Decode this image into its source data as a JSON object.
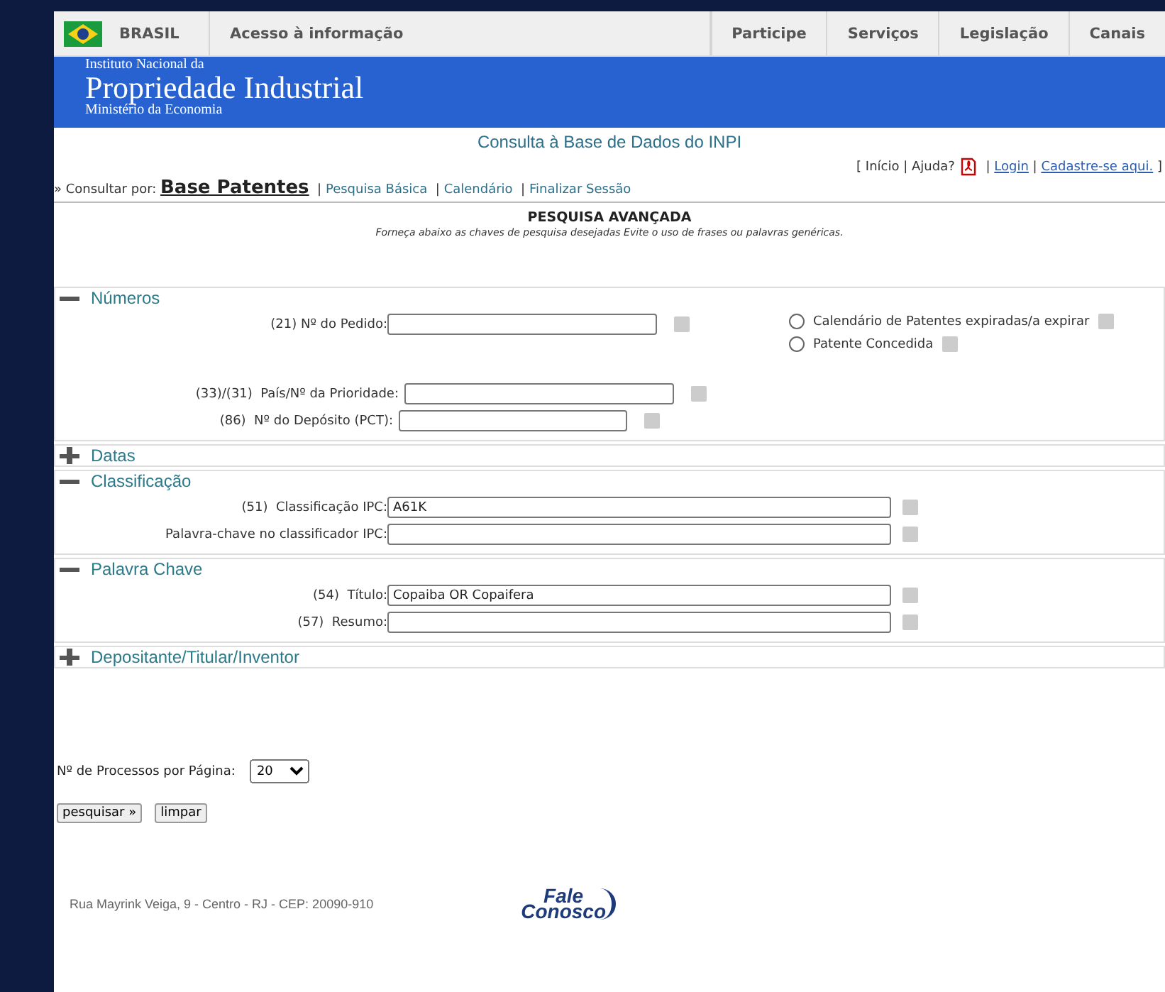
{
  "gov_bar": {
    "country": "BRASIL",
    "access": "Acesso à informação",
    "menu": [
      "Participe",
      "Serviços",
      "Legislação",
      "Canais"
    ]
  },
  "banner": {
    "line_1": "Instituto Nacional da",
    "line_2": "Propriedade Industrial",
    "line_3": "Ministério da Economia"
  },
  "page_title": "Consulta à Base de Dados do INPI",
  "header_links": [
    {
      "kind": "text",
      "text": "[ "
    },
    {
      "kind": "plain",
      "text": "Início"
    },
    {
      "kind": "text",
      "text": " | "
    },
    {
      "kind": "plain",
      "text": "Ajuda?"
    },
    {
      "kind": "pdf"
    },
    {
      "kind": "text",
      "text": " | "
    },
    {
      "kind": "link",
      "text": "Login"
    },
    {
      "kind": "text",
      "text": " | "
    },
    {
      "kind": "link",
      "text": "Cadastre-se aqui."
    },
    {
      "kind": "text",
      "text": " ]"
    }
  ],
  "consult_by": {
    "label": "» Consultar por:",
    "separator": "|",
    "items": [
      {
        "text": "Base Patentes",
        "selected": true
      },
      {
        "text": "Pesquisa Básica",
        "selected": false
      },
      {
        "text": "Calendário",
        "selected": false
      },
      {
        "text": "Finalizar Sessão",
        "selected": false
      }
    ]
  },
  "search_title": "PESQUISA AVANÇADA",
  "search_hint": "Forneça abaixo as chaves de pesquisa desejadas Evite o uso de frases ou palavras genéricas.",
  "sections": [
    {
      "title": "Números",
      "expanded": true,
      "fields": [
        {
          "label": "(21) Nº do Pedido:"
        },
        {
          "label": "(33)/(31)  País/Nº da Prioridade:"
        },
        {
          "label": "(86)  Nº do Depósito (PCT):"
        }
      ],
      "options": [
        {
          "label": "Calendário de Patentes expiradas/a expirar",
          "selected": false
        },
        {
          "label": "Patente Concedida",
          "selected": false
        }
      ]
    },
    {
      "title": "Datas",
      "expanded": false
    },
    {
      "title": "Classificação",
      "expanded": true,
      "fields": [
        {
          "label": "(51)  Classificação IPC:",
          "value": "A61K"
        },
        {
          "label": "Palavra-chave no classificador IPC:"
        }
      ]
    },
    {
      "title": "Palavra Chave",
      "expanded": true,
      "fields": [
        {
          "label": "(54)  Título:",
          "value": "Copaiba OR Copaifera"
        },
        {
          "label": "(57)  Resumo:"
        }
      ]
    },
    {
      "title": "Depositante/Titular/Inventor",
      "expanded": false
    }
  ],
  "per_page": {
    "label": "Nº de Processos por Página:",
    "value": "20"
  },
  "buttons": [
    "pesquisar »",
    "limpar"
  ],
  "footer": {
    "address": "Rua Mayrink Veiga, 9 - Centro - RJ - CEP: 20090-910",
    "logo_line_1": "Fale",
    "logo_line_2": "Conosco"
  }
}
